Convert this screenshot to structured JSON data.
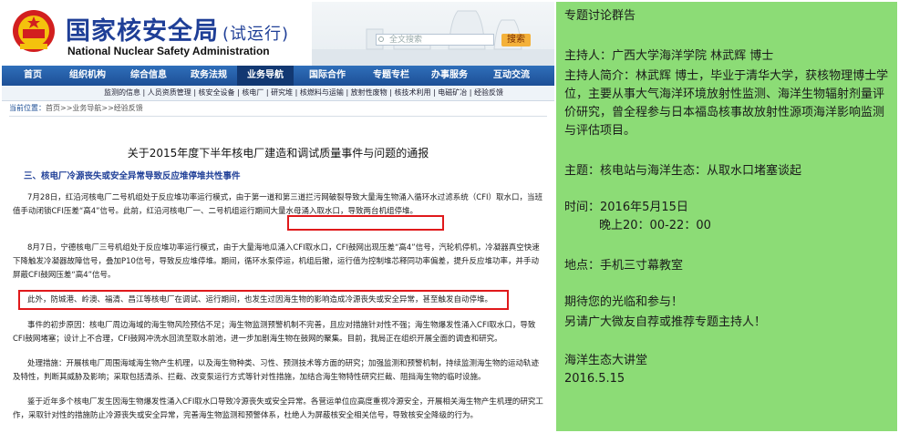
{
  "header": {
    "title": "国家核安全局",
    "title_note": "(试运行)",
    "subtitle": "National Nuclear Safety Administration",
    "search_placeholder": "全文搜索",
    "search_button": "搜索"
  },
  "nav": {
    "items": [
      "首页",
      "组织机构",
      "综合信息",
      "政务法规",
      "业务导航",
      "国际合作",
      "专题专栏",
      "办事服务",
      "互动交流"
    ],
    "active": "业务导航"
  },
  "subnav": {
    "text": "监测的信息 | 人员资质管理 | 核安全设备 | 核电厂 | 研究堆 | 核燃料与运输 | 放射性废物 | 核技术利用 | 电磁矿冶 | 经验反馈"
  },
  "breadcrumb": {
    "label": "当前位置：",
    "path": "首页>>业务导航>>经验反馈"
  },
  "article": {
    "title": "关于2015年度下半年核电厂建造和调试质量事件与问题的通报",
    "section_heading": "三、核电厂冷源丧失或安全异常导致反应堆停堆共性事件",
    "paragraphs": [
      "7月28日，红沿河核电厂二号机组处于反应堆功率运行模式，由于第一道和第三道拦污网破裂导致大量海生物涌入循环水过滤系统（CFI）取水口，当班值手动闭锁CFI压差“高4”信号。此前，红沿河核电厂一、二号机组运行期间大量水母涌入取水口，导致两台机组停堆。",
      "8月7日，宁德核电厂三号机组处于反应堆功率运行模式，由于大量海地瓜涌入CFI取水口，CFI鼓网出现压差“高4”信号，汽轮机停机，冷凝器真空快速下降触发冷凝器故障信号，叠加P10信号，导致反应堆停堆。期间，循环水泵停运，机组后撤，运行值为控制堆芯释同功率偏差，提升反应堆功率，并手动屏蔽CFI鼓网压差“高4”信号。",
      "此外，防城港、岭澳、福清、昌江等核电厂在调试、运行期间，也发生过因海生物的影响造成冷源丧失或安全异常，甚至触发自动停堆。",
      "事件的初步原因：核电厂周边海域的海生物风险预估不足；海生物监测预警机制不完善，且应对措施针对性不强；海生物爆发性涌入CFI取水口，导致CFI鼓网堵塞；设计上不合理，CFI鼓网冲洗水回流至取水前池，进一步加剧海生物在鼓网的聚集。目前，我局正在组织开展全面的调查和研究。",
      "处理措施：开展核电厂周围海域海生物产生机理，以及海生物种类、习性、预测技术等方面的研究；加强监测和预警机制，持续监测海生物的运动轨迹及特性，判断其威胁及影响；采取包括清杀、拦截、改变泵运行方式等针对性措施，加结合海生物特性研究拦截、阻挡海生物的临时设施。",
      "鉴于近年多个核电厂发生因海生物爆发性涌入CFI取水口导致冷源丧失或安全异常。各营运单位应高度重视冷源安全，开展相关海生物产生机理的研究工作，采取针对性的措施防止冷源丧失或安全异常，完善海生物监测和预警体系，杜绝人为屏蔽核安全相关信号，导致核安全降级的行为。"
    ]
  },
  "announcement": {
    "group_title": "专题讨论群告",
    "host": "主持人：广西大学海洋学院 林武辉 博士",
    "host_bio": "主持人简介：林武辉 博士，毕业于清华大学，获核物理博士学位，主要从事大气海洋环境放射性监测、海洋生物辐射剂量评价研究，曾全程参与日本福岛核事故放射性源项海洋影响监测与评估项目。",
    "topic": "主题：核电站与海洋生态：从取水口堵塞谈起",
    "date": "时间：2016年5月15日",
    "time": "晚上20：00-22：00",
    "location": "地点：手机三寸幕教室",
    "invite": "期待您的光临和参与！",
    "recruit": "另请广大微友自荐或推荐专题主持人！",
    "organizer": "海洋生态大讲堂",
    "sign_date": "2016.5.15"
  },
  "colors": {
    "nav_blue": "#1d4f96",
    "title_blue": "#1f3f97",
    "highlight_red": "#e0191b",
    "panel_green": "#8cdc76"
  }
}
